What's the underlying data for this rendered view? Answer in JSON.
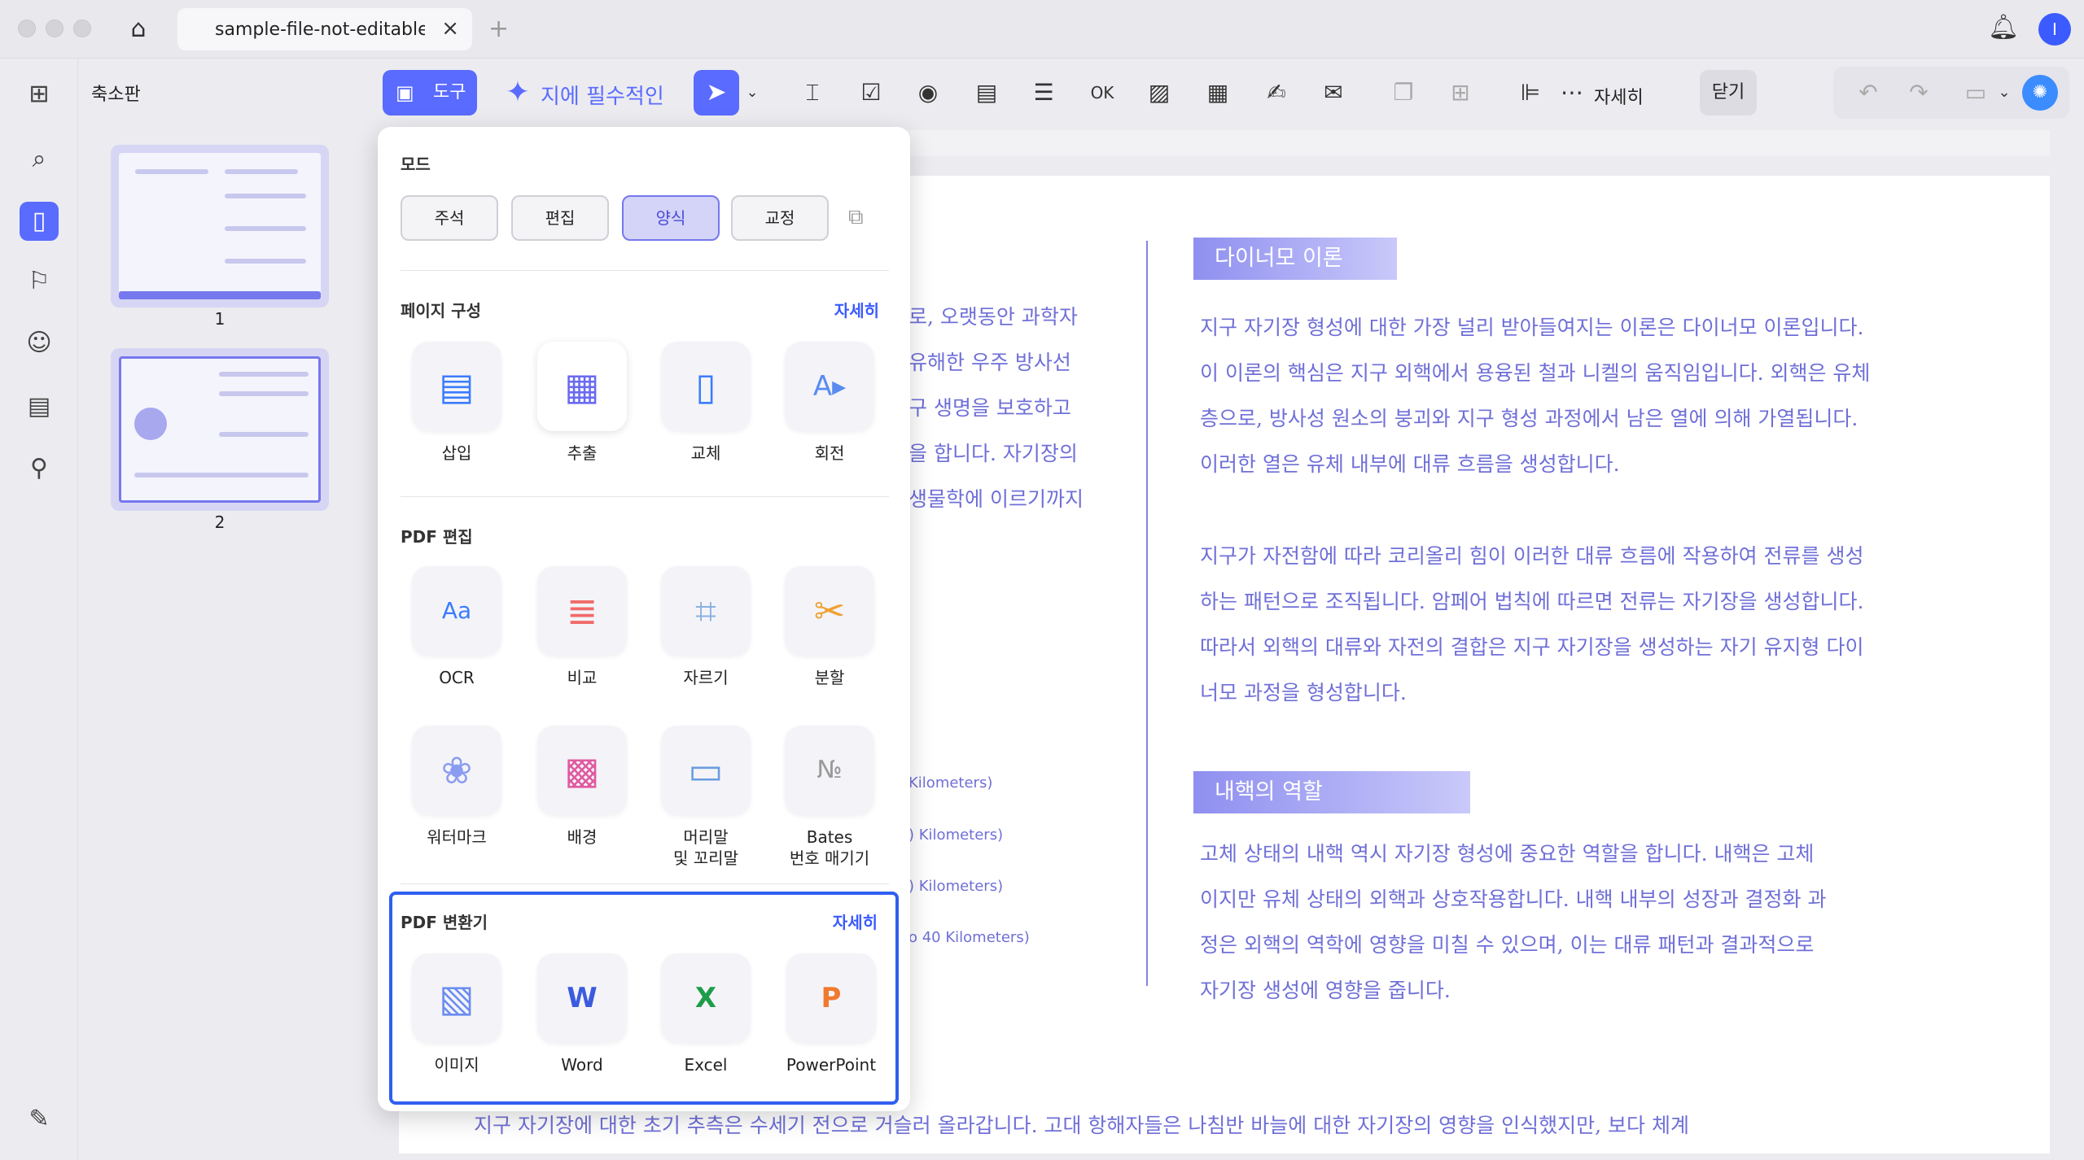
{
  "tab": {
    "title": "sample-file-not-editable-k",
    "close": "×",
    "add": "+"
  },
  "user": {
    "initial": "I"
  },
  "sidebar": {
    "title": "축소판",
    "pages": [
      "1",
      "2"
    ]
  },
  "toolbar": {
    "tools_label": "도구",
    "ai_hint": "지에 필수적인",
    "more_label": "자세히",
    "close_label": "닫기"
  },
  "dropdown": {
    "mode": {
      "title": "모드",
      "buttons": [
        "주석",
        "편집",
        "양식",
        "교정"
      ],
      "active": "양식"
    },
    "page_setup": {
      "title": "페이지 구성",
      "more": "자세히",
      "items": [
        "삽입",
        "추출",
        "교체",
        "회전"
      ]
    },
    "pdf_edit": {
      "title": "PDF 편집",
      "items": [
        "OCR",
        "비교",
        "자르기",
        "분할"
      ],
      "items2": [
        {
          "line1": "워터마크",
          "line2": ""
        },
        {
          "line1": "배경",
          "line2": ""
        },
        {
          "line1": "머리말",
          "line2": "및 꼬리말"
        },
        {
          "line1": "Bates",
          "line2": "번호 매기기"
        }
      ]
    },
    "converter": {
      "title": "PDF 변환기",
      "more": "자세히",
      "items": [
        "이미지",
        "Word",
        "Excel",
        "PowerPoint"
      ]
    }
  },
  "document": {
    "left_fragments": [
      "로, 오랫동안 과학자",
      "유해한 우주 방사선",
      "구 생명을 보호하고",
      "을 합니다. 자기장의",
      "생물학에 이르기까지"
    ],
    "km_fragments": [
      "Kilometers)",
      ") Kilometers)",
      ") Kilometers)",
      "o 40 Kilometers)"
    ],
    "heading1": "다이너모 이론",
    "para1": [
      "지구 자기장 형성에 대한 가장 널리 받아들여지는 이론은 다이너모 이론입니다.",
      "이 이론의 핵심은 지구 외핵에서 용융된 철과 니켈의 움직임입니다. 외핵은 유체",
      "층으로, 방사성 원소의 붕괴와 지구 형성 과정에서 남은 열에 의해 가열됩니다.",
      "이러한 열은 유체 내부에 대류 흐름을 생성합니다."
    ],
    "para2": [
      "지구가 자전함에 따라 코리올리 힘이 이러한 대류 흐름에 작용하여 전류를 생성",
      "하는 패턴으로 조직됩니다. 암페어 법칙에 따르면 전류는 자기장을 생성합니다.",
      "따라서 외핵의 대류와 자전의 결합은 지구 자기장을 생성하는 자기 유지형 다이",
      "너모 과정을 형성합니다."
    ],
    "heading2": "내핵의 역할",
    "para3": [
      "고체 상태의 내핵 역시 자기장 형성에 중요한 역할을 합니다. 내핵은 고체",
      "이지만 유체 상태의 외핵과 상호작용합니다. 내핵 내부의 성장과 결정화 과",
      "정은 외핵의 역학에 영향을 미칠 수 있으며, 이는 대류 패턴과 결과적으로",
      "자기장 생성에 영향을 줍니다."
    ],
    "bottom_line": "지구 자기장에 대한 초기 추측은 수세기 전으로 거슬러 올라갑니다. 고대 항해자들은 나침반 바늘에 대한 자기장의 영향을 인식했지만, 보다 체계"
  },
  "colors": {
    "accent": "#5a6bff",
    "doc_text": "#6f6fd8",
    "converter_border": "#2f5ff0"
  }
}
